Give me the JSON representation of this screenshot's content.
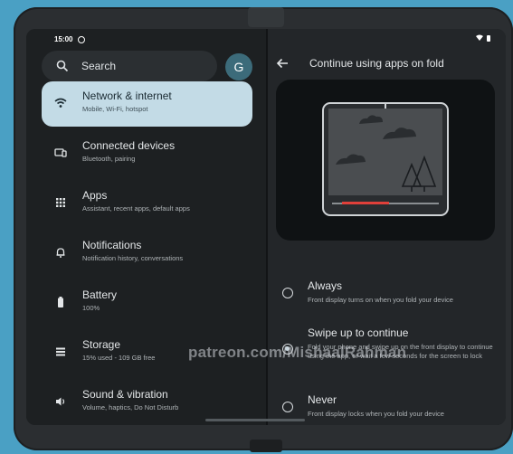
{
  "status": {
    "time": "15:00",
    "left_icon": "circle-icon",
    "right_icons": "wifi battery"
  },
  "search": {
    "label": "Search",
    "icon": "search-icon"
  },
  "avatar": {
    "letter": "G"
  },
  "settings": [
    {
      "title": "Network & internet",
      "subtitle": "Mobile, Wi-Fi, hotspot",
      "icon": "wifi-icon",
      "active": true
    },
    {
      "title": "Connected devices",
      "subtitle": "Bluetooth, pairing",
      "icon": "devices-icon",
      "active": false
    },
    {
      "title": "Apps",
      "subtitle": "Assistant, recent apps, default apps",
      "icon": "apps-grid-icon",
      "active": false
    },
    {
      "title": "Notifications",
      "subtitle": "Notification history, conversations",
      "icon": "bell-icon",
      "active": false
    },
    {
      "title": "Battery",
      "subtitle": "100%",
      "icon": "battery-icon",
      "active": false
    },
    {
      "title": "Storage",
      "subtitle": "15% used - 109 GB free",
      "icon": "storage-icon",
      "active": false
    },
    {
      "title": "Sound & vibration",
      "subtitle": "Volume, haptics, Do Not Disturb",
      "icon": "speaker-icon",
      "active": false
    }
  ],
  "detail": {
    "title": "Continue using apps on fold",
    "options": [
      {
        "title": "Always",
        "desc": "Front display turns on when you fold your device",
        "selected": false
      },
      {
        "title": "Swipe up to continue",
        "desc": "Fold your phone and swipe up on the front display to continue using the app, or wait a few seconds for the screen to lock",
        "selected": true
      },
      {
        "title": "Never",
        "desc": "Front display locks when you fold your device",
        "selected": false
      }
    ]
  },
  "watermark": "patreon.com/MishaalRahman",
  "colors": {
    "active_item": "#c3dbe6",
    "accent_red": "#e0403a"
  }
}
